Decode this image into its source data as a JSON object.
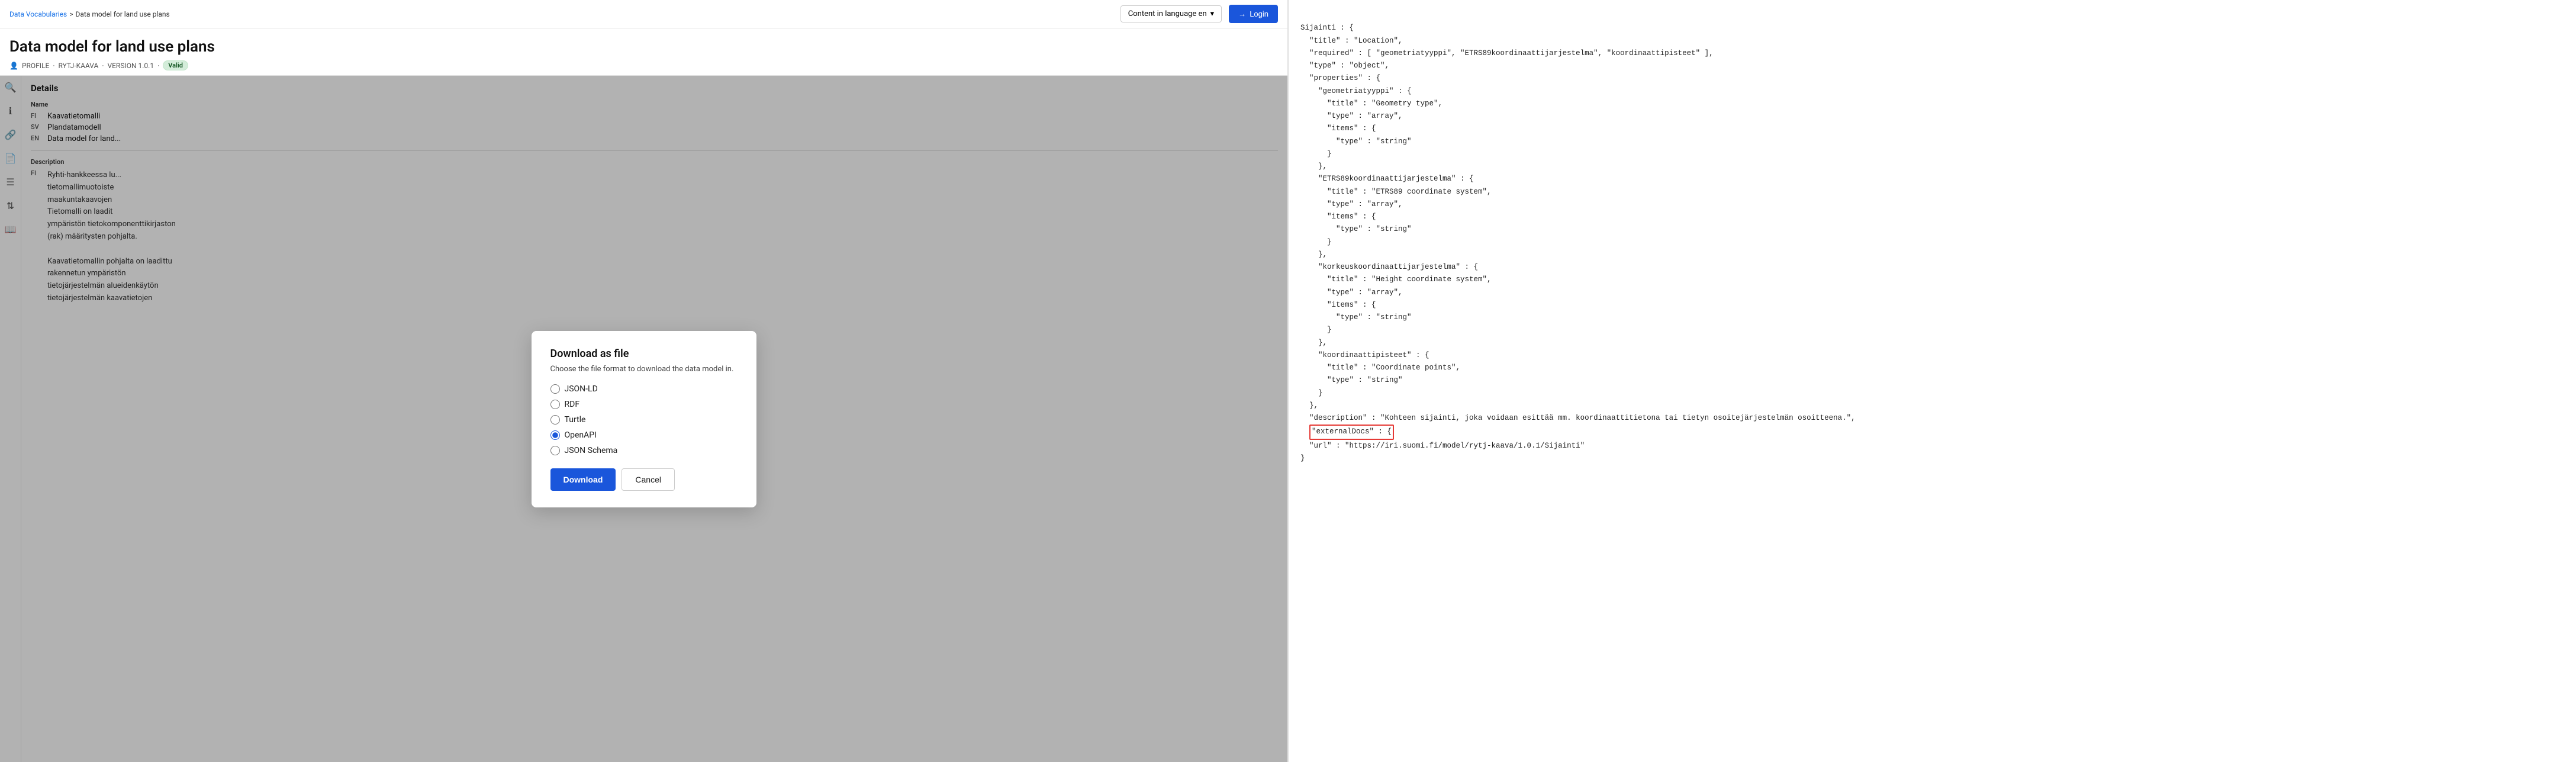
{
  "breadcrumb": {
    "parent": "Data Vocabularies",
    "separator": ">",
    "current": "Data model for land use plans"
  },
  "header": {
    "page_title": "Data model for land use plans",
    "meta": {
      "icon_label": "profile-icon",
      "profile": "PROFILE",
      "separator1": "·",
      "vocab": "RYTJ-KAAVA",
      "separator2": "·",
      "version": "VERSION 1.0.1",
      "separator3": "·",
      "badge": "Valid"
    },
    "lang_selector": {
      "label": "Content in language en",
      "placeholder": "Content in language en"
    },
    "login_button": "Login"
  },
  "sidebar_icons": [
    {
      "name": "search-icon",
      "symbol": "🔍"
    },
    {
      "name": "info-icon",
      "symbol": "ℹ"
    },
    {
      "name": "link-icon",
      "symbol": "🔗"
    },
    {
      "name": "document-icon",
      "symbol": "📄"
    },
    {
      "name": "list-icon",
      "symbol": "☰"
    },
    {
      "name": "sort-icon",
      "symbol": "⇅"
    },
    {
      "name": "book-icon",
      "symbol": "📖"
    }
  ],
  "details": {
    "section_title": "Details",
    "name_label": "Name",
    "names": [
      {
        "lang": "FI",
        "value": "Kaavatietomalli"
      },
      {
        "lang": "SV",
        "value": "Plandatamodell"
      },
      {
        "lang": "EN",
        "value": "Data model for land..."
      }
    ],
    "description_label": "Description",
    "descriptions": [
      {
        "lang": "FI",
        "value": "Ryhti-hankkeessa lu...\ntietomallimuotoiste\nmaakuntakaavojen\nTietomalli on laadit\nympäristön tietokomponenttikirjaston\n(rak) määritysten pohjalta.\n\nKaavatietomallin pohjalta on laadittu\nrakennetun ympäristön\ntietojärjestelmän alueidenkäytön\ntietojärjestelmän kaavatietojen"
      }
    ]
  },
  "modal": {
    "title": "Download as file",
    "subtitle": "Choose the file format to download the data model in.",
    "options": [
      {
        "id": "json-ld",
        "label": "JSON-LD",
        "checked": false
      },
      {
        "id": "rdf",
        "label": "RDF",
        "checked": false
      },
      {
        "id": "turtle",
        "label": "Turtle",
        "checked": false
      },
      {
        "id": "openapi",
        "label": "OpenAPI",
        "checked": true
      },
      {
        "id": "json-schema",
        "label": "JSON Schema",
        "checked": false
      }
    ],
    "download_button": "Download",
    "cancel_button": "Cancel"
  },
  "code_content": {
    "lines": [
      "Sijainti : {",
      "  \"title\" : \"Location\",",
      "  \"required\" : [ \"geometriatyyppi\", \"ETRS89koordinaattijarjestelma\", \"koordinaattipisteet\" ],",
      "  \"type\" : \"object\",",
      "  \"properties\" : {",
      "    \"geometriatyyppi\" : {",
      "      \"title\" : \"Geometry type\",",
      "      \"type\" : \"array\",",
      "      \"items\" : {",
      "        \"type\" : \"string\"",
      "      }",
      "    },",
      "    \"ETRS89koordinaattijarjestelma\" : {",
      "      \"title\" : \"ETRS89 coordinate system\",",
      "      \"type\" : \"array\",",
      "      \"items\" : {",
      "        \"type\" : \"string\"",
      "      }",
      "    },",
      "    \"korkeuskoordinaattijarjestelma\" : {",
      "      \"title\" : \"Height coordinate system\",",
      "      \"type\" : \"array\",",
      "      \"items\" : {",
      "        \"type\" : \"string\"",
      "      }",
      "    },",
      "    \"koordinaattipisteet\" : {",
      "      \"title\" : \"Coordinate points\",",
      "      \"type\" : \"string\"",
      "    }",
      "  },",
      "  \"description\" : \"Kohteen sijainti, joka voidaan esittää mm. koordinaattitietona tai tietyn osoitejärjestelmän osoitteena.\",",
      "  \"externalDocs\" : {",
      "  \"url\" : \"https://iri.suomi.fi/model/rytj-kaava/1.0.1/Sijainti\"",
      "}"
    ],
    "highlighted_line_index": 33,
    "highlighted_text": "\"externalDocs\" : {"
  }
}
